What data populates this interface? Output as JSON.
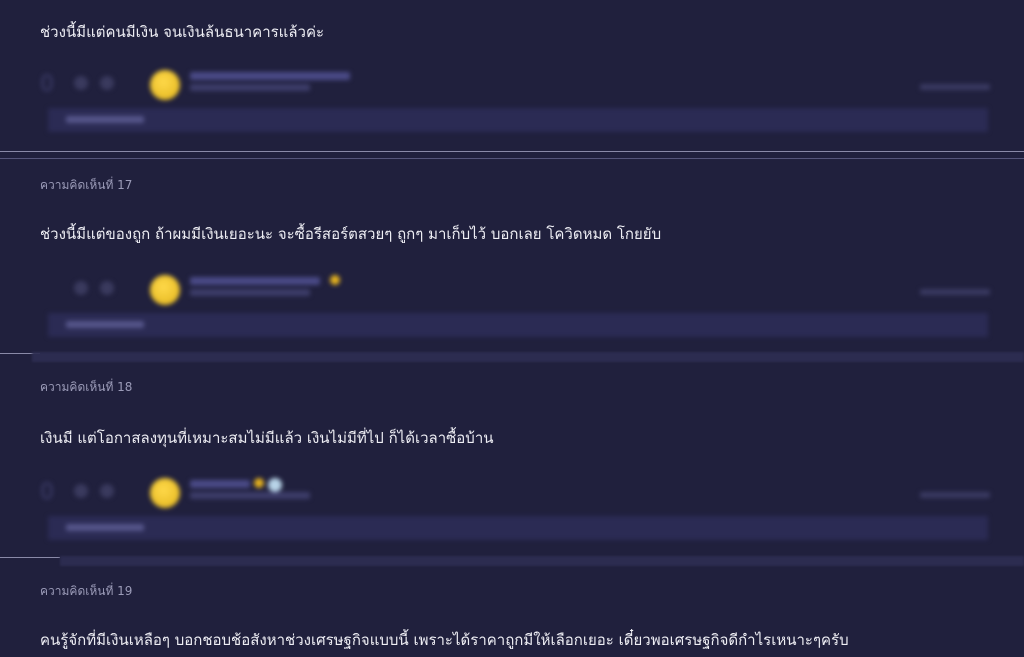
{
  "comments": [
    {
      "label": "",
      "text": "ช่วงนี้มีแต่คนมีเงิน จนเงินล้นธนาคารแล้วค่ะ",
      "votes": "0"
    },
    {
      "label": "ความคิดเห็นที่ 17",
      "text": "ช่วงนี้มีแต่ของถูก ถ้าผมมีเงินเยอะนะ จะซื้อรีสอร์ตสวยๆ ถูกๆ มาเก็บไว้ บอกเลย โควิดหมด โกยยับ",
      "votes": ""
    },
    {
      "label": "ความคิดเห็นที่ 18",
      "text": "เงินมี แต่โอกาสลงทุนที่เหมาะสมไม่มีแล้ว เงินไม่มีที่ไป ก็ได้เวลาซื้อบ้าน",
      "votes": "0"
    },
    {
      "label": "ความคิดเห็นที่ 19",
      "text": "คนรู้จักที่มีเงินเหลือๆ บอกชอบช้อสังหาช่วงเศรษฐกิจแบบนี้ เพราะได้ราคาถูกมีให้เลือกเยอะ เดี๋ยวพอเศรษฐกิจดีกำไรเหนาะๆครับ",
      "votes": ""
    }
  ],
  "colors": {
    "background": "#20203d",
    "reply_box": "#2b2b54",
    "avatar": "#ffd94a",
    "divider": "#8a8aa8"
  },
  "icons": [
    "upvote-icon",
    "downvote-icon",
    "avatar-icon",
    "member-badge-icon",
    "report-icon"
  ]
}
